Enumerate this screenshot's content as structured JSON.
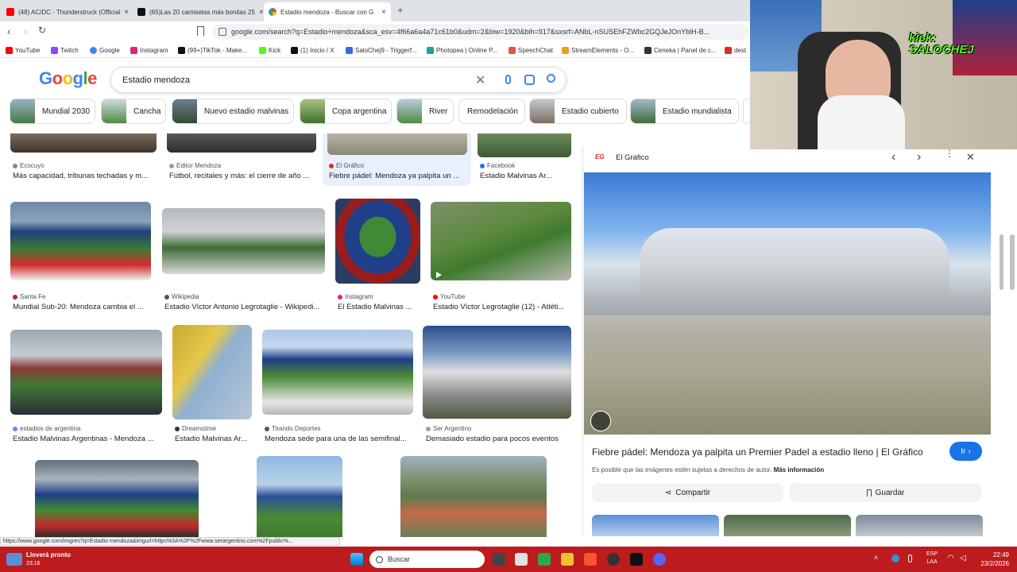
{
  "tabs": [
    {
      "label": "(48) AC/DC - Thunderstruck (Official",
      "close": "×"
    },
    {
      "label": "(65)Las 20 camisetas más bonitas 25",
      "close": "×"
    },
    {
      "label": "Estadio mendoza - Buscar con G",
      "close": "×"
    }
  ],
  "new_tab": "+",
  "address": {
    "url": "google.com/search?q=Estadio+mendoza&sca_esv=4f66a6a4a71c61b0&udm=2&biw=1920&bih=917&sxsrf=ANbL-nSUSEhFZWbc2GQJeJOnYblH-B..."
  },
  "bookmarks": [
    {
      "label": "YouTube",
      "color": "#ff0000"
    },
    {
      "label": "Twitch",
      "color": "#9146ff"
    },
    {
      "label": "Google",
      "color": "#4285f4"
    },
    {
      "label": "Instagram",
      "color": "#d62976"
    },
    {
      "label": "(99+)TikTok - Make...",
      "color": "#111111"
    },
    {
      "label": "Kick",
      "color": "#53fc18"
    },
    {
      "label": "(1) Inicio / X",
      "color": "#111111"
    },
    {
      "label": "SaloChej9 - Triggerf...",
      "color": "#3a6bd9"
    },
    {
      "label": "Photopea | Online P...",
      "color": "#18a497"
    },
    {
      "label": "SpeechChat",
      "color": "#e5534b"
    },
    {
      "label": "StreamElements - O...",
      "color": "#e8a020"
    },
    {
      "label": "Ceneka | Panel de c...",
      "color": "#333333"
    },
    {
      "label": "dest",
      "color": "#d93025"
    }
  ],
  "google": {
    "logo": [
      {
        "ch": "G",
        "color": "#4285f4"
      },
      {
        "ch": "o",
        "color": "#ea4335"
      },
      {
        "ch": "o",
        "color": "#fbbc05"
      },
      {
        "ch": "g",
        "color": "#4285f4"
      },
      {
        "ch": "l",
        "color": "#34a853"
      },
      {
        "ch": "e",
        "color": "#ea4335"
      }
    ],
    "query": "Estadio mendoza"
  },
  "chips": [
    {
      "label": "Mundial 2030",
      "thumb": true
    },
    {
      "label": "Cancha",
      "thumb": true
    },
    {
      "label": "Nuevo estadio malvinas",
      "thumb": true
    },
    {
      "label": "Copa argentina",
      "thumb": true
    },
    {
      "label": "River",
      "thumb": true
    },
    {
      "label": "Remodelación",
      "thumb": false
    },
    {
      "label": "Estadio cubierto",
      "thumb": true
    },
    {
      "label": "Estadio mundialista",
      "thumb": true
    }
  ],
  "results_row1": [
    {
      "source": "Ecocuyo",
      "title": "Más capacidad, tribunas techadas y m...",
      "dot": "#7d8b99"
    },
    {
      "source": "Editor Mendoza",
      "title": "Fútbol, recitales y más: el cierre de año ...",
      "dot": "#9aa0a6"
    },
    {
      "source": "El Gráfico",
      "title": "Fiebre pádel: Mendoza ya palpita un ...",
      "dot": "#d93025"
    },
    {
      "source": "Facebook",
      "title": "Estadio Malvinas Ar...",
      "dot": "#1877f2"
    }
  ],
  "results_row2": [
    {
      "source": "Santa Fe",
      "title": "Mundial Sub-20: Mendoza cambia el ...",
      "dot": "#c2185b"
    },
    {
      "source": "Wikipedia",
      "title": "Estadio Víctor Antonio Legrotaglie - Wikipedi...",
      "dot": "#555555"
    },
    {
      "source": "Instagram",
      "title": "El Estadio Malvinas ...",
      "dot": "#d62976"
    },
    {
      "source": "YouTube",
      "title": "Estadio Víctor Legrotaglie (12) - Atléti...",
      "dot": "#ff0000"
    }
  ],
  "results_row3": [
    {
      "source": "estadios de argentina",
      "title": "Estadio Malvinas Argentinas - Mendoza ...",
      "dot": "#5f8fd6"
    },
    {
      "source": "Dreamstime",
      "title": "Estadio Malvinas Ar...",
      "dot": "#333333"
    },
    {
      "source": "Tirando Deportes",
      "title": "Mendoza sede para una de las semifinal...",
      "dot": "#555555"
    },
    {
      "source": "Ser Argentino",
      "title": "Demasiado estadio para pocos eventos",
      "dot": "#9aa0a6"
    }
  ],
  "panel": {
    "source_badge": "EG",
    "source": "El Gráfico",
    "title": "Fiebre pádel: Mendoza ya palpita un Premier Padel a estadio lleno | El Gráfico",
    "go_label": "Ir",
    "rights": "Es posible que las imágenes estén sujetas a derechos de autor.",
    "more_info": "Más información",
    "share": "Compartir",
    "save": "Guardar"
  },
  "webcam": {
    "overlay_line1": "kick:",
    "overlay_line2": "SALOCHEJ"
  },
  "status_url": "https://www.google.com/imgres?q=Estadio mendoza&imgurl=https%3A%2F%2Fwww.serargentino.com%2Fpublic%...",
  "taskbar": {
    "weather": "Lloverá pronto",
    "weather_time": "23:16",
    "search": "Buscar",
    "lang1": "ESP",
    "lang2": "LAA",
    "time": "22:49",
    "date": "23/2/2026"
  }
}
